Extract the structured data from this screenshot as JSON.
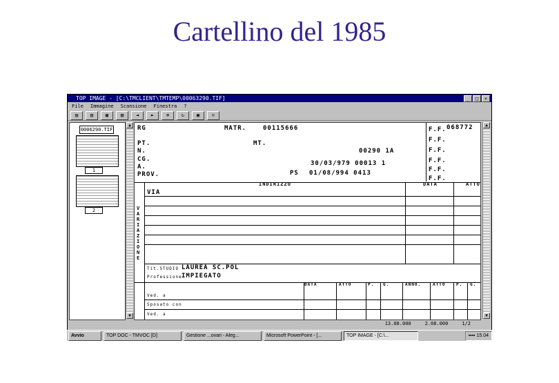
{
  "slide": {
    "title": "Cartellino del 1985"
  },
  "window": {
    "title": "TOP IMAGE - [C:\\TMCLIENT\\TMTEMP\\00063290.TIF]",
    "menu": [
      "File",
      "Immagine",
      "Scansione",
      "Finestra",
      "?"
    ],
    "thumb_input": "0006290.TIF",
    "thumb_labels": [
      "1",
      "2"
    ]
  },
  "card": {
    "col1": [
      "RG",
      "PT.",
      "N.",
      "CG.",
      "A.",
      "PROV."
    ],
    "matr_label": "MATR.",
    "matr_value": "00115666",
    "mt_label": "MT.",
    "code1": "00290 1A",
    "date1": "30/03/979 00013 1",
    "ps_label": "PS",
    "date2": "01/08/994 0413",
    "ff_labels": [
      "F.F.",
      "F.F.",
      "F.F.",
      "F.F.",
      "F.F.",
      "F.F."
    ],
    "ff_value": "068772",
    "indirizzo": "INDIRIZZO",
    "data": "DATA",
    "atto": "ATTO",
    "via": "VIA",
    "variazione": "VARIAZIONE",
    "titstudio_label": "Tit.STUDIO",
    "titstudio_value": "LAUREA SC.POL",
    "professione_label": "Professione",
    "professione_value": "IMPIEGATO",
    "table_headers": [
      "DATA",
      "ATTO",
      "P.",
      "G.",
      "ANNO.",
      "ATTO",
      "P.",
      "G."
    ],
    "rows": [
      "Ved. a",
      "Sposato con",
      "Ved. a"
    ]
  },
  "status": {
    "left": "13.08.000",
    "mid": "2.08.000",
    "right": "1/2"
  },
  "taskbar": {
    "start": "Avvio",
    "tasks": [
      "TOP DOC - TMVOC [D]",
      "Gestione ...ovari - Aleg...",
      "Microsoft PowerPoint - [...",
      "TOP IMAGE - [C:\\..."
    ],
    "clock": "15.04"
  }
}
